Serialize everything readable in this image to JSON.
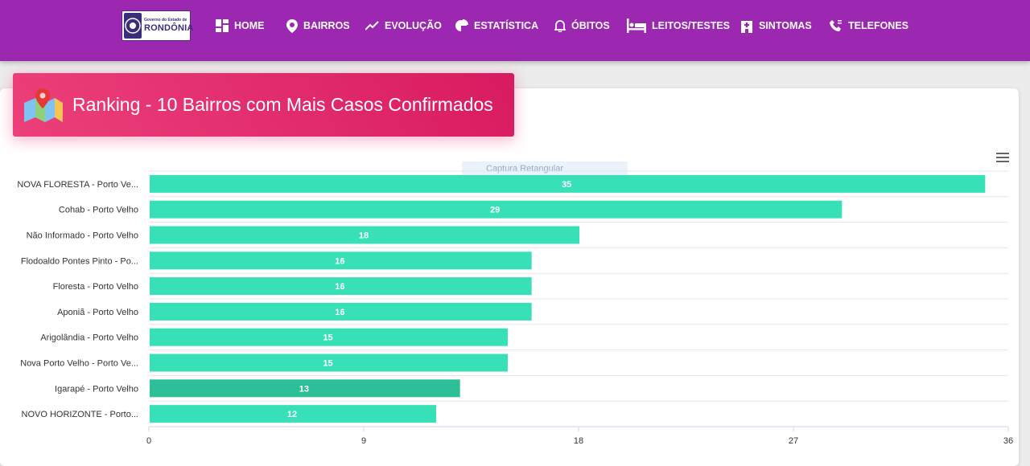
{
  "nav": {
    "logo_small": "Governo do Estado de",
    "logo_big": "RONDÔNIA",
    "items": [
      {
        "label": "HOME",
        "icon": "dashboard-icon"
      },
      {
        "label": "BAIRROS",
        "icon": "map-pin-icon"
      },
      {
        "label": "EVOLUÇÃO",
        "icon": "trending-up-icon"
      },
      {
        "label": "ESTATÍSTICA",
        "icon": "pie-chart-icon"
      },
      {
        "label": "ÓBITOS",
        "icon": "bell-icon"
      },
      {
        "label": "LEITOS/TESTES",
        "icon": "hotel-bed-icon"
      },
      {
        "label": "SINTOMAS",
        "icon": "hospital-building-icon"
      },
      {
        "label": "TELEFONES",
        "icon": "phone-icon"
      }
    ],
    "background_color": "#9c27b0"
  },
  "panel": {
    "title": "Ranking - 10 Bairros com Mais Casos Confirmados",
    "header_color": "#e91e63",
    "ghost_tooltip": "Captura Retangular"
  },
  "chart_data": {
    "type": "bar",
    "orientation": "horizontal",
    "categories": [
      "NOVA FLORESTA - Porto Ve...",
      "Cohab - Porto Velho",
      "Não Informado - Porto Velho",
      "Flodoaldo Pontes Pinto - Po...",
      "Floresta - Porto Velho",
      "Aponiã - Porto Velho",
      "Arigolândia - Porto Velho",
      "Nova Porto Velho - Porto Ve...",
      "Igarapé - Porto Velho",
      "NOVO HORIZONTE - Porto..."
    ],
    "values": [
      35,
      29,
      18,
      16,
      16,
      16,
      15,
      15,
      13,
      12
    ],
    "xlim": [
      0,
      36
    ],
    "xticks": [
      0,
      9,
      18,
      27,
      36
    ],
    "bar_color": "#38e0b8",
    "highlight_color": "#2dbf98",
    "highlight_index": 8,
    "grid": true,
    "data_labels": true
  }
}
